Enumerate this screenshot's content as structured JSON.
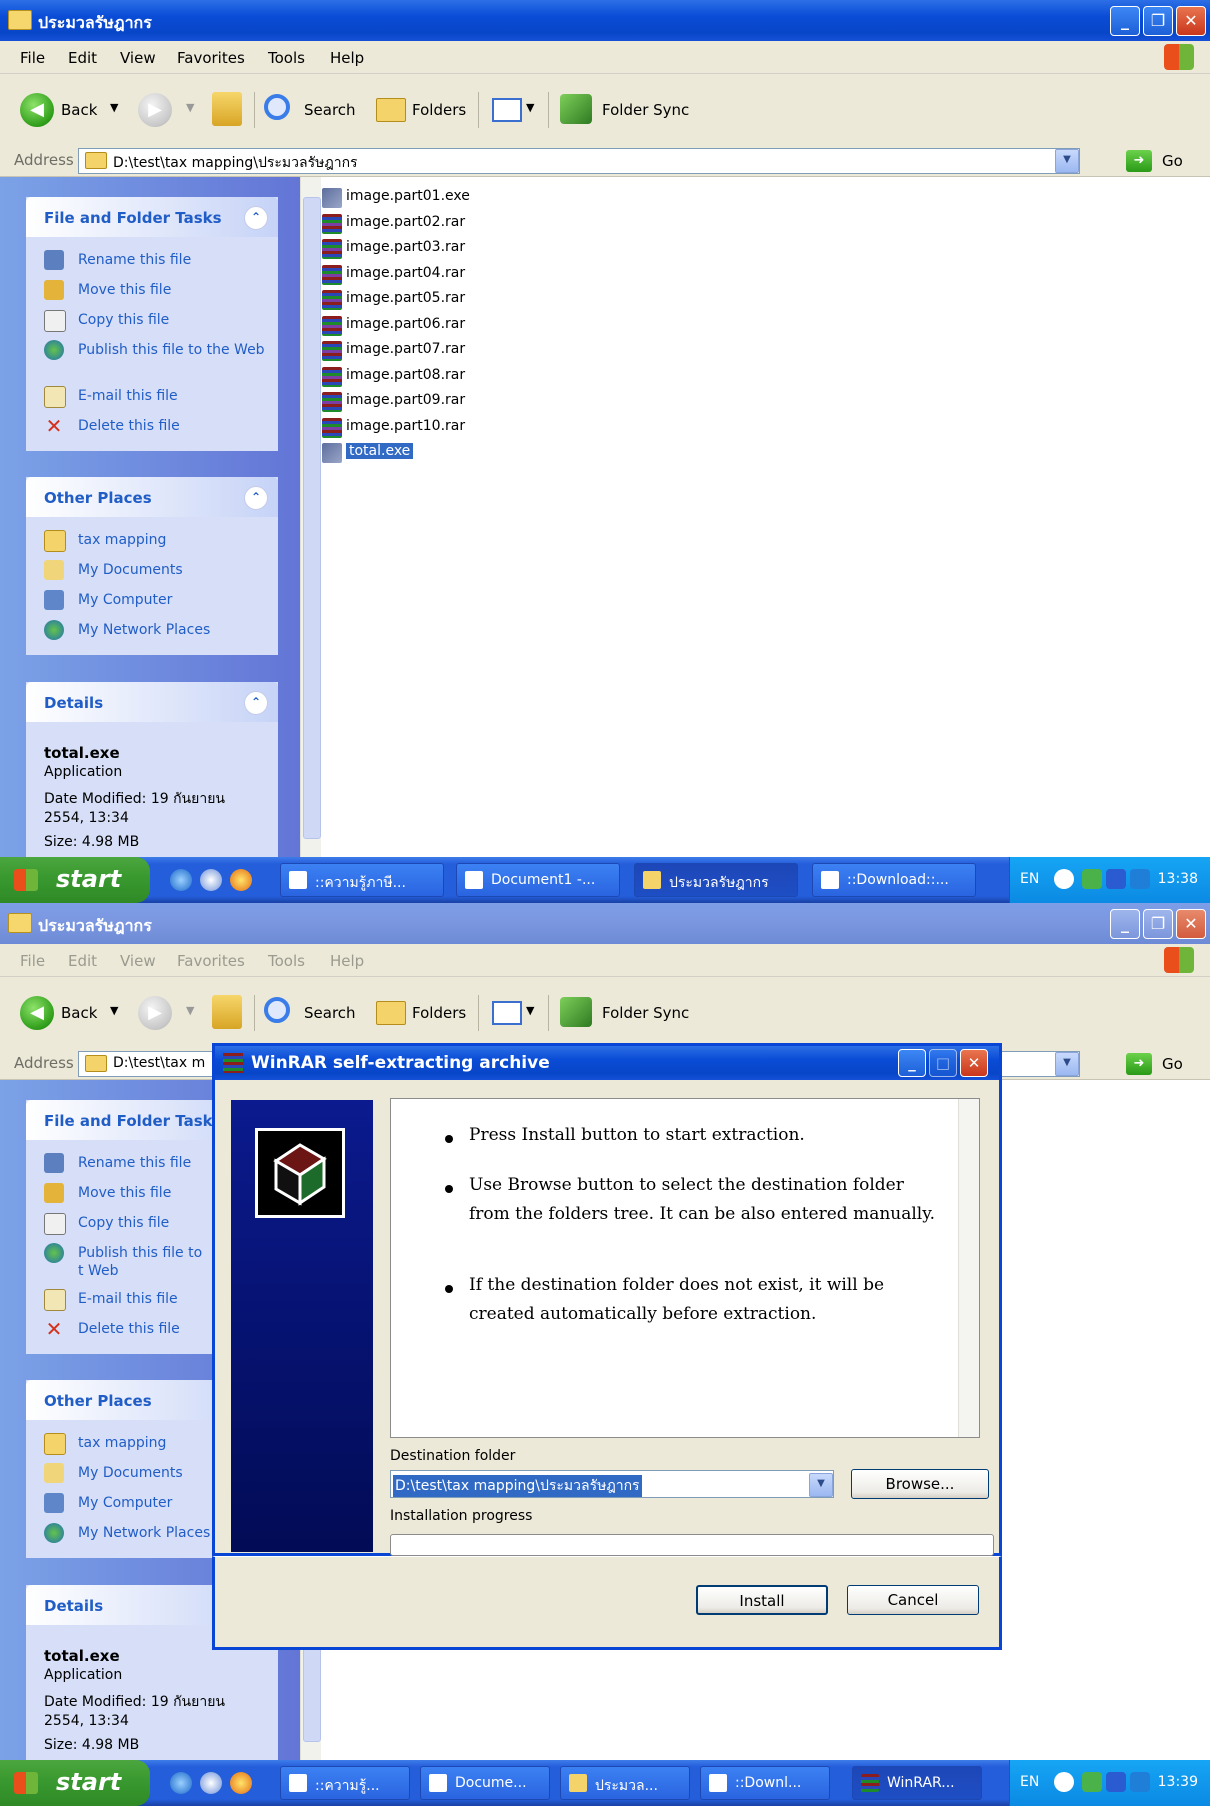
{
  "shots": [
    {
      "window": {
        "title": "ประมวลรัษฎากร",
        "icon": "folder-icon",
        "active": true
      },
      "menu": [
        "File",
        "Edit",
        "View",
        "Favorites",
        "Tools",
        "Help"
      ],
      "toolbar": {
        "back": "Back",
        "search": "Search",
        "folders": "Folders",
        "sync": "Folder Sync"
      },
      "address": {
        "label": "Address",
        "path": "D:\\test\\tax mapping\\ประมวลรัษฎากร",
        "go": "Go"
      },
      "tasks_panel": {
        "title": "File and Folder Tasks",
        "items": [
          "Rename this file",
          "Move this file",
          "Copy this file",
          "Publish this file to the Web",
          "E-mail this file",
          "Delete this file"
        ]
      },
      "places_panel": {
        "title": "Other Places",
        "items": [
          "tax mapping",
          "My Documents",
          "My Computer",
          "My Network Places"
        ]
      },
      "details_panel": {
        "title": "Details",
        "name": "total.exe",
        "type": "Application",
        "modified": "Date Modified: 19 กันยายน 2554, 13:34",
        "size": "Size: 4.98 MB"
      },
      "files": [
        {
          "name": "image.part01.exe",
          "kind": "exe"
        },
        {
          "name": "image.part02.rar",
          "kind": "rar"
        },
        {
          "name": "image.part03.rar",
          "kind": "rar"
        },
        {
          "name": "image.part04.rar",
          "kind": "rar"
        },
        {
          "name": "image.part05.rar",
          "kind": "rar"
        },
        {
          "name": "image.part06.rar",
          "kind": "rar"
        },
        {
          "name": "image.part07.rar",
          "kind": "rar"
        },
        {
          "name": "image.part08.rar",
          "kind": "rar"
        },
        {
          "name": "image.part09.rar",
          "kind": "rar"
        },
        {
          "name": "image.part10.rar",
          "kind": "rar"
        },
        {
          "name": "total.exe",
          "kind": "exe",
          "selected": true
        }
      ],
      "taskbar": {
        "start": "start",
        "buttons": [
          "::ความรู้ภาษี...",
          "Document1 -...",
          "ประมวลรัษฎากร",
          "::Download::..."
        ],
        "active_index": 2,
        "lang": "EN",
        "clock": "13:38"
      }
    },
    {
      "window": {
        "title": "ประมวลรัษฎากร",
        "icon": "folder-icon",
        "active": false
      },
      "menu": [
        "File",
        "Edit",
        "View",
        "Favorites",
        "Tools",
        "Help"
      ],
      "toolbar": {
        "back": "Back",
        "search": "Search",
        "folders": "Folders",
        "sync": "Folder Sync"
      },
      "address": {
        "label": "Address",
        "path": "D:\\test\\tax m",
        "go": "Go"
      },
      "tasks_panel": {
        "title": "File and Folder Task",
        "items": [
          "Rename this file",
          "Move this file",
          "Copy this file",
          "Publish this file to t Web",
          "E-mail this file",
          "Delete this file"
        ]
      },
      "places_panel": {
        "title": "Other Places",
        "items": [
          "tax mapping",
          "My Documents",
          "My Computer",
          "My Network Places"
        ]
      },
      "details_panel": {
        "title": "Details",
        "name": "total.exe",
        "type": "Application",
        "modified": "Date Modified: 19 กันยายน 2554, 13:34",
        "size": "Size: 4.98 MB"
      },
      "taskbar": {
        "start": "start",
        "buttons": [
          "::ความรู้...",
          "Docume...",
          "ประมวล...",
          "::Downl...",
          "WinRAR..."
        ],
        "active_index": 4,
        "lang": "EN",
        "clock": "13:39"
      },
      "dialog": {
        "title": "WinRAR self-extracting archive",
        "bullets": [
          "Press Install button to start extraction.",
          "Use Browse button to select the destination folder from the folders tree. It can be also entered manually.",
          "If the destination folder does not exist, it will be created automatically before extraction."
        ],
        "dest_label": "Destination folder",
        "dest_value": "D:\\test\\tax mapping\\ประมวลรัษฎากร",
        "browse": "Browse...",
        "progress_label": "Installation progress",
        "progress_value": 0,
        "install": "Install",
        "cancel": "Cancel"
      }
    }
  ],
  "colors": {
    "xp_blue": "#0a4cd6",
    "task_link": "#215dc6",
    "selection": "#316ac5",
    "taskbar": "#245edb",
    "start_green": "#3a9a30"
  }
}
